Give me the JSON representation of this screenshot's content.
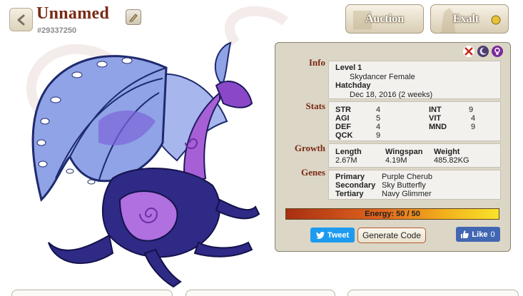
{
  "header": {
    "back_icon": "chevron-left-icon",
    "title": "Unnamed",
    "edit_icon": "pencil-icon",
    "dragon_id": "#29337250",
    "auction_label": "Auction",
    "exalt_label": "Exalt"
  },
  "status_icons": [
    "no-breed-icon",
    "moon-icon",
    "female-symbol-icon"
  ],
  "info": {
    "label": "Info",
    "level": "Level 1",
    "breed": "Skydancer Female",
    "hatchday_label": "Hatchday",
    "hatchday": "Dec 18, 2016 (2 weeks)"
  },
  "stats": {
    "label": "Stats",
    "items": [
      {
        "name": "STR",
        "value": "4"
      },
      {
        "name": "AGI",
        "value": "5"
      },
      {
        "name": "DEF",
        "value": "4"
      },
      {
        "name": "QCK",
        "value": "9"
      },
      {
        "name": "INT",
        "value": "9"
      },
      {
        "name": "VIT",
        "value": "4"
      },
      {
        "name": "MND",
        "value": "9"
      }
    ]
  },
  "growth": {
    "label": "Growth",
    "length_label": "Length",
    "length": "2.67M",
    "wingspan_label": "Wingspan",
    "wingspan": "4.19M",
    "weight_label": "Weight",
    "weight": "485.82KG"
  },
  "genes": {
    "label": "Genes",
    "primary_label": "Primary",
    "primary": "Purple Cherub",
    "secondary_label": "Secondary",
    "secondary": "Sky Butterfly",
    "tertiary_label": "Tertiary",
    "tertiary": "Navy Glimmer"
  },
  "energy": {
    "text": "Energy: 50 / 50",
    "fraction": 1.0
  },
  "social": {
    "tweet_label": "Tweet",
    "generate_code_label": "Generate Code",
    "like_label": "Like",
    "like_count": "0"
  },
  "colors": {
    "title": "#7a2a14",
    "panel_bg": "#dcd6c6",
    "wing": "#8fa3e6",
    "body": "#2e2a86",
    "accent": "#9a4fcf"
  }
}
